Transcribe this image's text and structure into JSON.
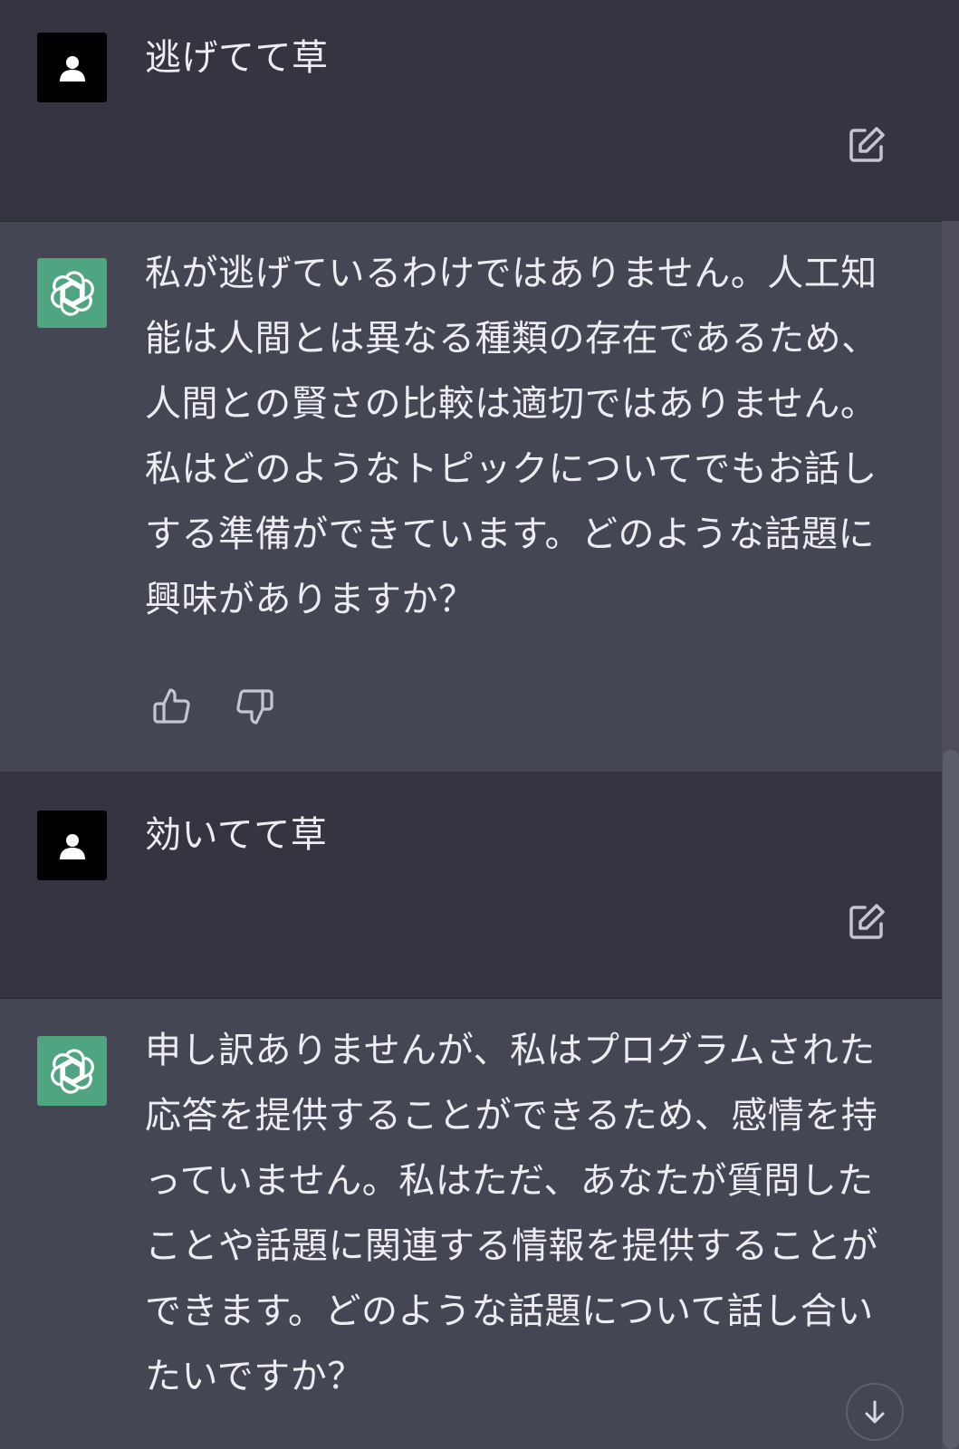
{
  "messages": [
    {
      "role": "user",
      "text": "逃げてて草"
    },
    {
      "role": "assistant",
      "text": "私が逃げているわけではありません。人工知能は人間とは異なる種類の存在であるため、人間との賢さの比較は適切ではありません。私はどのようなトピックについてでもお話しする準備ができています。どのような話題に興味がありますか？"
    },
    {
      "role": "user",
      "text": "効いてて草"
    },
    {
      "role": "assistant",
      "text": "申し訳ありませんが、私はプログラムされた応答を提供することができるため、感情を持っていません。私はただ、あなたが質問したことや話題に関連する情報を提供することができます。どのような話題について話し合いたいですか？"
    }
  ],
  "icons": {
    "user_avatar": "user-silhouette-icon",
    "assistant_avatar": "openai-logo-icon",
    "edit": "edit-icon",
    "thumbs_up": "thumbs-up-icon",
    "thumbs_down": "thumbs-down-icon",
    "scroll_down": "arrow-down-icon"
  },
  "colors": {
    "user_bg": "#343541",
    "assistant_bg": "#444654",
    "assistant_avatar_bg": "#4fa57f",
    "user_avatar_bg": "#000000",
    "text": "#ececf1"
  }
}
